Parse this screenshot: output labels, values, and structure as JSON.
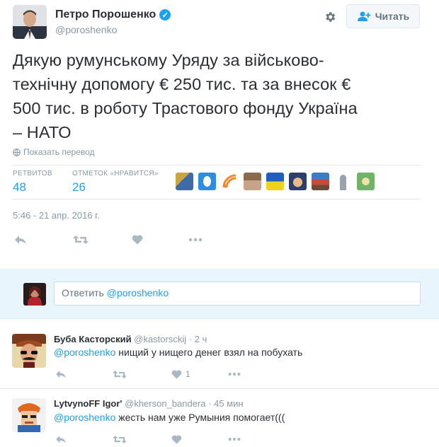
{
  "tweet": {
    "author_name": "Петро Порошенко",
    "author_handle": "@poroshenko",
    "follow_label": "Читать",
    "text_lines": [
      "Дякую румунському Уряду за військово-",
      "технічну допомогу € 250 тис. та за внесок €",
      "500 тис. в роботу Трастового фонду Україна",
      "– НАТО"
    ],
    "translate_label": "Показать перевод",
    "retweets_label": "РЕТВИТОВ",
    "retweets_count": "48",
    "likes_label": "ОТМЕТОК «НРАВИТСЯ»",
    "likes_count": "26",
    "timestamp": "5:46 - 21 апр. 2016 г."
  },
  "reply_box": {
    "placeholder_prefix": "Ответить ",
    "placeholder_mention": "@poroshenko"
  },
  "comments": [
    {
      "name": "Буба Касторский",
      "handle": "@kastorsckij",
      "dot": "·",
      "time": "2 ч",
      "mention": "@poroshenko",
      "text": " нищий у нищего денег взял на побухать",
      "like_count": "1"
    },
    {
      "name": "LytvynoFF Igor'",
      "handle": "@kherson_bandera",
      "dot": "·",
      "time": "45 мин",
      "mention": "@poroshenko",
      "text": " жесть нам уже Румыния помогает(((",
      "like_count": ""
    }
  ],
  "colors": {
    "accent": "#1da1f2",
    "muted": "#8899a6",
    "reply_bg": "#e8f5fd",
    "like_icon_color": "#aab8c2"
  },
  "icons": [
    "verified-badge-icon",
    "gear-icon",
    "follow-person-icon",
    "globe-icon",
    "reply-icon",
    "retweet-icon",
    "heart-icon",
    "more-icon"
  ]
}
